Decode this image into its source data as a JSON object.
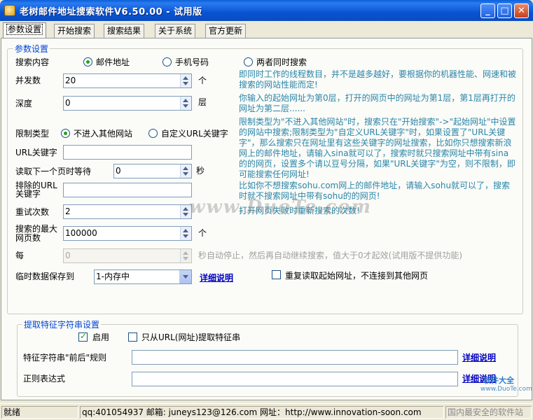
{
  "window": {
    "title": "老树邮件地址搜索软件V6.50.00 - 试用版",
    "min_glyph": "_",
    "max_glyph": "□",
    "close_glyph": "✕"
  },
  "tabs": [
    {
      "label": "参数设置",
      "active": true
    },
    {
      "label": "开始搜索"
    },
    {
      "label": "搜索结果"
    },
    {
      "label": "关于系统"
    },
    {
      "label": "官方更新"
    }
  ],
  "params": {
    "legend": "参数设置",
    "search_content_label": "搜索内容",
    "radio_email": "邮件地址",
    "radio_phone": "手机号码",
    "radio_both": "两者同时搜索",
    "concurrency_label": "并发数",
    "concurrency_value": "20",
    "concurrency_unit": "个",
    "concurrency_help": "即同时工作的线程数目，并不是越多越好，要根据你的机器性能、网速和被搜索的网站性能而定!",
    "depth_label": "深度",
    "depth_value": "0",
    "depth_unit": "层",
    "depth_help": "你输入的起始网址为第0层，打开的网页中的网址为第1层，第1层再打开的网址为第二层......",
    "limit_label": "限制类型",
    "limit_radio_no_other": "不进入其他网站",
    "limit_radio_custom": "自定义URL关键字",
    "limit_help": "限制类型为\"不进入其他网站\"时，搜索只在\"开始搜索\"->\"起始网址\"中设置的网站中搜索;限制类型为\"自定义URL关键字\"时，如果设置了\"URL关键字\"，那么搜索只在网址里有这些关键字的网址搜索，比如你只想搜索新浪网上的邮件地址，请输入sina就可以了，搜索时就只搜索网址中带有sina的的网页，设置多个请以豆号分隔，如果\"URL关键字\"为空，则不限制，即可能搜索任何网址!",
    "url_keyword_label": "URL关键字",
    "url_keyword_value": "",
    "wait_label": "读取下一个页时等待",
    "wait_value": "0",
    "wait_unit": "秒",
    "exclude_label_1": "排除的URL",
    "exclude_label_2": "关键字",
    "exclude_value": "",
    "exclude_help": "比如你不想搜索sohu.com网上的邮件地址，请输入sohu就可以了，搜索时就不搜索网址中带有sohu的的网页!",
    "retry_label": "重试次数",
    "retry_value": "2",
    "retry_help": "打开网页失败时重新搜索的次数!",
    "max_pages_label_1": "搜索的最大",
    "max_pages_label_2": "网页数",
    "max_pages_value": "100000",
    "max_pages_unit": "个",
    "every_label": "每",
    "every_value": "0",
    "every_help": "秒自动停止，然后再自动继续搜索，值大于0才起效(试用版不提供功能)",
    "temp_label": "临时数据保存到",
    "temp_value": "1-内存中",
    "temp_link": "详细说明",
    "reread_label": "重复读取起始网址，不连接到其他网页"
  },
  "feature": {
    "legend": "提取特征字符串设置",
    "enable_label": "启用",
    "only_url_label": "只从URL(网址)提取特征串",
    "rule_label": "特征字符串\"前后\"规则",
    "rule_value": "",
    "rule_link": "详细说明",
    "regex_label": "正则表达式",
    "regex_value": "",
    "regex_link": "详细说明"
  },
  "status": {
    "state": "就绪",
    "contact": "qq:401054937 邮箱: juneys123@126.com 网址：http://www.innovation-soon.com"
  },
  "watermark": {
    "text": "www.DuoTe.com",
    "logo_1": "软件大全",
    "logo_2": "www.DuoTe.com",
    "logo_3": "国内最安全的软件站"
  }
}
